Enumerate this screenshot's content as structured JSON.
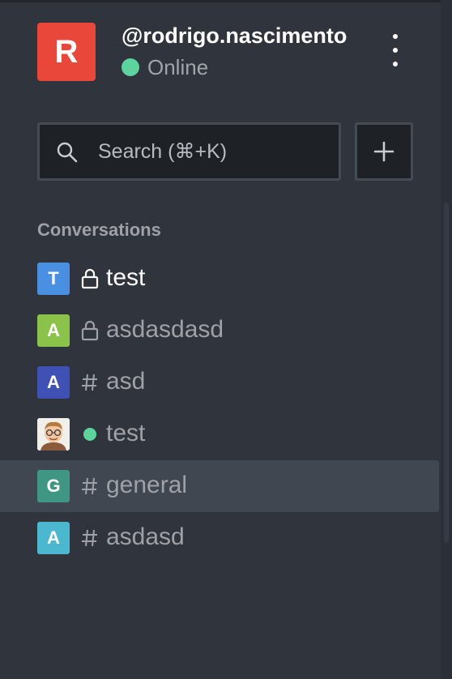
{
  "user": {
    "initial": "R",
    "avatar_color": "#e8473a",
    "username": "@rodrigo.nascimento",
    "status": "Online",
    "status_color": "#5dd39e"
  },
  "search": {
    "placeholder": "Search (⌘+K)"
  },
  "icons": {
    "search": "search-icon",
    "add": "plus-icon",
    "menu": "kebab-menu-icon",
    "private": "lock-icon",
    "public": "hash-icon",
    "direct": "presence-dot"
  },
  "section": {
    "title": "Conversations"
  },
  "conversations": [
    {
      "initial": "T",
      "color": "#4a90e2",
      "type": "private",
      "name": "test",
      "unread": true
    },
    {
      "initial": "A",
      "color": "#8bc34a",
      "type": "private",
      "name": "asdasdasd",
      "unread": false
    },
    {
      "initial": "A",
      "color": "#3f51b5",
      "type": "public",
      "name": "asd",
      "unread": false
    },
    {
      "initial": "",
      "color": "#f1efe9",
      "type": "direct",
      "name": "test",
      "unread": false
    },
    {
      "initial": "G",
      "color": "#3e9683",
      "type": "public",
      "name": "general",
      "unread": false,
      "selected": true
    },
    {
      "initial": "A",
      "color": "#4cb8cf",
      "type": "public",
      "name": "asdasd",
      "unread": false
    }
  ]
}
